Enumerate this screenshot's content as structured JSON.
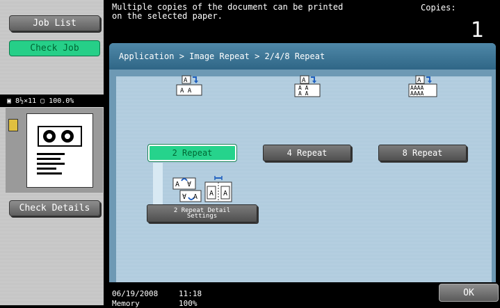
{
  "sidebar": {
    "job_list": "Job List",
    "check_job": "Check Job",
    "paper_info": "8½×11",
    "zoom": "100.0%",
    "check_details": "Check Details"
  },
  "header": {
    "message": "Multiple copies of the document can be printed\non the selected paper.",
    "copies_label": "Copies:",
    "copies_value": "1"
  },
  "breadcrumb": "Application > Image Repeat > 2/4/8 Repeat",
  "repeat_options": [
    {
      "label": "2 Repeat",
      "selected": true,
      "icon": "two-repeat-icon"
    },
    {
      "label": "4 Repeat",
      "selected": false,
      "icon": "four-repeat-icon"
    },
    {
      "label": "8 Repeat",
      "selected": false,
      "icon": "eight-repeat-icon"
    }
  ],
  "detail_settings": "2 Repeat Detail\nSettings",
  "footer": {
    "date": "06/19/2008",
    "time": "11:18",
    "memory_label": "Memory",
    "memory_value": "100%",
    "ok": "OK"
  },
  "colors": {
    "selected_green": "#26d38c",
    "panel_blue": "#6e99b4",
    "header_blue": "#2f6686"
  }
}
